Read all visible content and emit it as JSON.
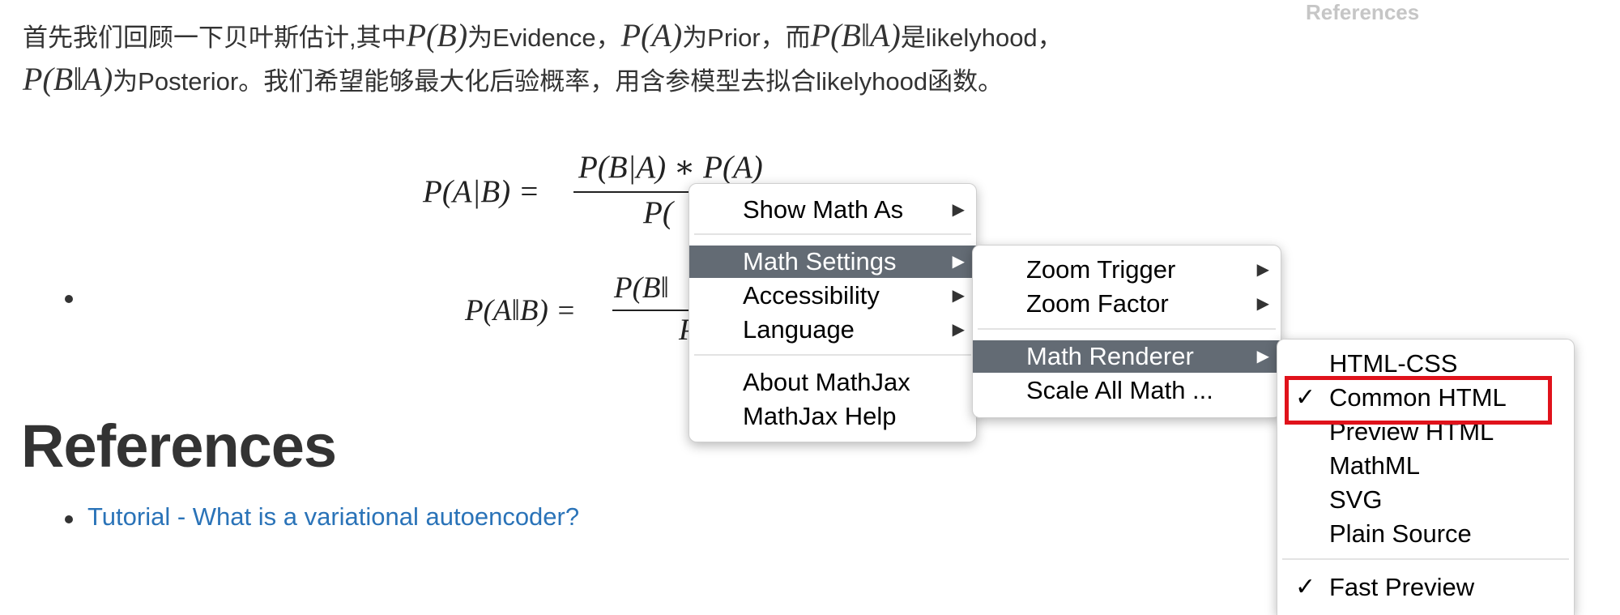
{
  "sidebar_ghost_title": "References",
  "intro": {
    "line1": {
      "t1": "首先我们回顾一下贝叶斯估计,其中",
      "m1": "P(B)",
      "t2": "为Evidence，",
      "m2": "P(A)",
      "t3": "为Prior，而",
      "m3": "P(B‖A)",
      "t4": "是likelyhood，"
    },
    "line2": {
      "m1": "P(B‖A)",
      "t1": "为Posterior。我们希望能够最大化后验概率，用含参模型去拟合likelyhood函数。"
    }
  },
  "equation1": {
    "lhs": "P(A|B) =",
    "numerator": "P(B|A) ∗ P(A)",
    "denominator_visible": "P("
  },
  "equation2": {
    "lhs": "P(A‖B) =",
    "numerator_visible": "P(B‖",
    "denominator_visible": "P"
  },
  "references": {
    "heading": "References",
    "links": [
      "Tutorial - What is a variational autoencoder?"
    ]
  },
  "menu_main": {
    "items": [
      {
        "label": "Show Math As",
        "arrow": "▶"
      },
      {
        "label": "Math Settings",
        "arrow": "▶"
      },
      {
        "label": "Accessibility",
        "arrow": "▶"
      },
      {
        "label": "Language",
        "arrow": "▶"
      },
      {
        "label": "About MathJax"
      },
      {
        "label": "MathJax Help"
      }
    ]
  },
  "menu_settings": {
    "items": [
      {
        "label": "Zoom Trigger",
        "arrow": "▶"
      },
      {
        "label": "Zoom Factor",
        "arrow": "▶"
      },
      {
        "label": "Math Renderer",
        "arrow": "▶"
      },
      {
        "label": "Scale All Math ..."
      }
    ]
  },
  "menu_renderer": {
    "check_mark": "✓",
    "items": [
      {
        "label": "HTML-CSS",
        "checked": false
      },
      {
        "label": "Common HTML",
        "checked": true
      },
      {
        "label": "Preview HTML",
        "checked": false
      },
      {
        "label": "MathML",
        "checked": false
      },
      {
        "label": "SVG",
        "checked": false
      },
      {
        "label": "Plain Source",
        "checked": false
      },
      {
        "label": "Fast Preview",
        "checked": true
      }
    ]
  },
  "colors": {
    "menu_active_bg": "#636b74",
    "highlight_border": "#e0121b",
    "link": "#2a73b8"
  }
}
